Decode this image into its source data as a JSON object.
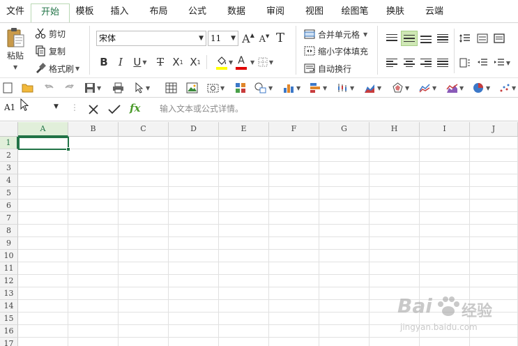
{
  "menu": {
    "tabs": [
      {
        "label": "文件",
        "active": false
      },
      {
        "label": "开始",
        "active": true
      },
      {
        "label": "模板",
        "active": false
      },
      {
        "label": "插入",
        "active": false
      },
      {
        "label": "布局",
        "active": false
      },
      {
        "label": "公式",
        "active": false
      },
      {
        "label": "数据",
        "active": false
      },
      {
        "label": "审阅",
        "active": false
      },
      {
        "label": "视图",
        "active": false
      },
      {
        "label": "绘图笔",
        "active": false
      },
      {
        "label": "换肤",
        "active": false
      },
      {
        "label": "云端",
        "active": false
      }
    ]
  },
  "ribbon": {
    "clipboard": {
      "paste": "粘贴",
      "cut": "剪切",
      "copy": "复制",
      "format_painter": "格式刷"
    },
    "font": {
      "name": "宋体",
      "size": "11",
      "bold": "B",
      "italic": "I",
      "underline": "U",
      "strike": "T",
      "subscript": "X",
      "sub_mark": "1",
      "superscript": "X",
      "super_mark": "1",
      "grow": "A",
      "shrink": "A",
      "clear": "T",
      "font_color_glyph": "A"
    },
    "merge": {
      "merge_center": "合并单元格",
      "shrink_fit": "缩小字体填充",
      "wrap_text": "自动换行"
    },
    "colors": {
      "fill_highlight": "#ffff00",
      "font_red": "#e00000",
      "active_green": "#217346",
      "accent_light": "#cfe8b5"
    }
  },
  "formula_bar": {
    "name_box": "A1",
    "fx": "fx",
    "placeholder": "输入文本或公式详情。"
  },
  "sheet": {
    "columns": [
      "A",
      "B",
      "C",
      "D",
      "E",
      "F",
      "G",
      "H",
      "I",
      "J"
    ],
    "rows": [
      "1",
      "2",
      "3",
      "4",
      "5",
      "6",
      "7",
      "8",
      "9",
      "10",
      "11",
      "12",
      "13",
      "14",
      "15",
      "16",
      "17"
    ],
    "active_cell": "A1"
  },
  "watermark": {
    "brand": "Bai",
    "brand_tail": "经验",
    "url": "jingyan.baidu.com"
  }
}
